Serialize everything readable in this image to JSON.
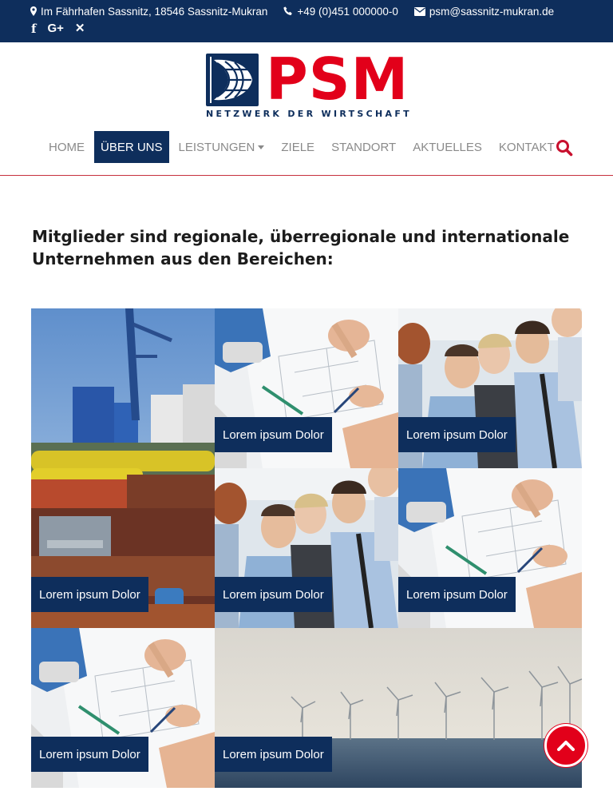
{
  "topbar": {
    "address": "Im Fährhafen Sassnitz, 18546 Sassnitz-Mukran",
    "phone": "+49 (0)451 000000-0",
    "email": "psm@sassnitz-mukran.de",
    "social": {
      "facebook": "f",
      "googleplus": "G+",
      "xing": "✕"
    }
  },
  "logo": {
    "text": "PSM",
    "subtitle": "NETZWERK DER WIRTSCHAFT"
  },
  "nav": {
    "items": [
      "HOME",
      "ÜBER UNS",
      "LEISTUNGEN",
      "ZIELE",
      "STANDORT",
      "AKTUELLES",
      "KONTAKT"
    ],
    "active": "ÜBER UNS"
  },
  "intro": {
    "text": "Mitglieder sind regionale, überregionale und internationale Unternehmen aus den Bereichen:"
  },
  "tiles": [
    {
      "label": "Lorem ipsum Dolor",
      "image": "port-harbor"
    },
    {
      "label": "Lorem ipsum Dolor",
      "image": "blueprint-hands"
    },
    {
      "label": "Lorem ipsum Dolor",
      "image": "team-meeting"
    },
    {
      "label": "Lorem ipsum Dolor",
      "image": "team-meeting"
    },
    {
      "label": "Lorem ipsum Dolor",
      "image": "blueprint-hands"
    },
    {
      "label": "Lorem ipsum Dolor",
      "image": "blueprint-hands"
    },
    {
      "label": "Lorem ipsum Dolor",
      "image": "wind-farm"
    }
  ],
  "colors": {
    "navy": "#0e2e5c",
    "red": "#e2001a"
  }
}
